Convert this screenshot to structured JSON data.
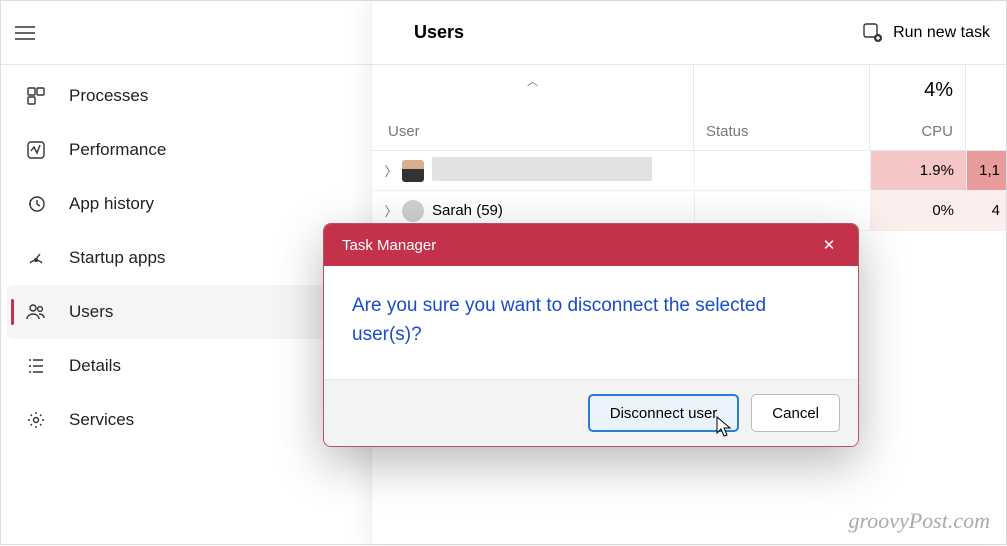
{
  "header": {
    "title": "Users",
    "run_task": "Run new task"
  },
  "sidebar": {
    "items": [
      {
        "label": "Processes"
      },
      {
        "label": "Performance"
      },
      {
        "label": "App history"
      },
      {
        "label": "Startup apps"
      },
      {
        "label": "Users"
      },
      {
        "label": "Details"
      },
      {
        "label": "Services"
      }
    ]
  },
  "columns": {
    "user": "User",
    "status": "Status",
    "cpu_label": "CPU",
    "cpu_value": "4%"
  },
  "rows": [
    {
      "name": "",
      "cpu": "1.9%",
      "mem": "1,1"
    },
    {
      "name": "Sarah (59)",
      "cpu": "0%",
      "mem": "4"
    }
  ],
  "dialog": {
    "title": "Task Manager",
    "message": "Are you sure you want to disconnect the selected user(s)?",
    "confirm": "Disconnect user",
    "cancel": "Cancel"
  },
  "watermark": "groovyPost.com"
}
